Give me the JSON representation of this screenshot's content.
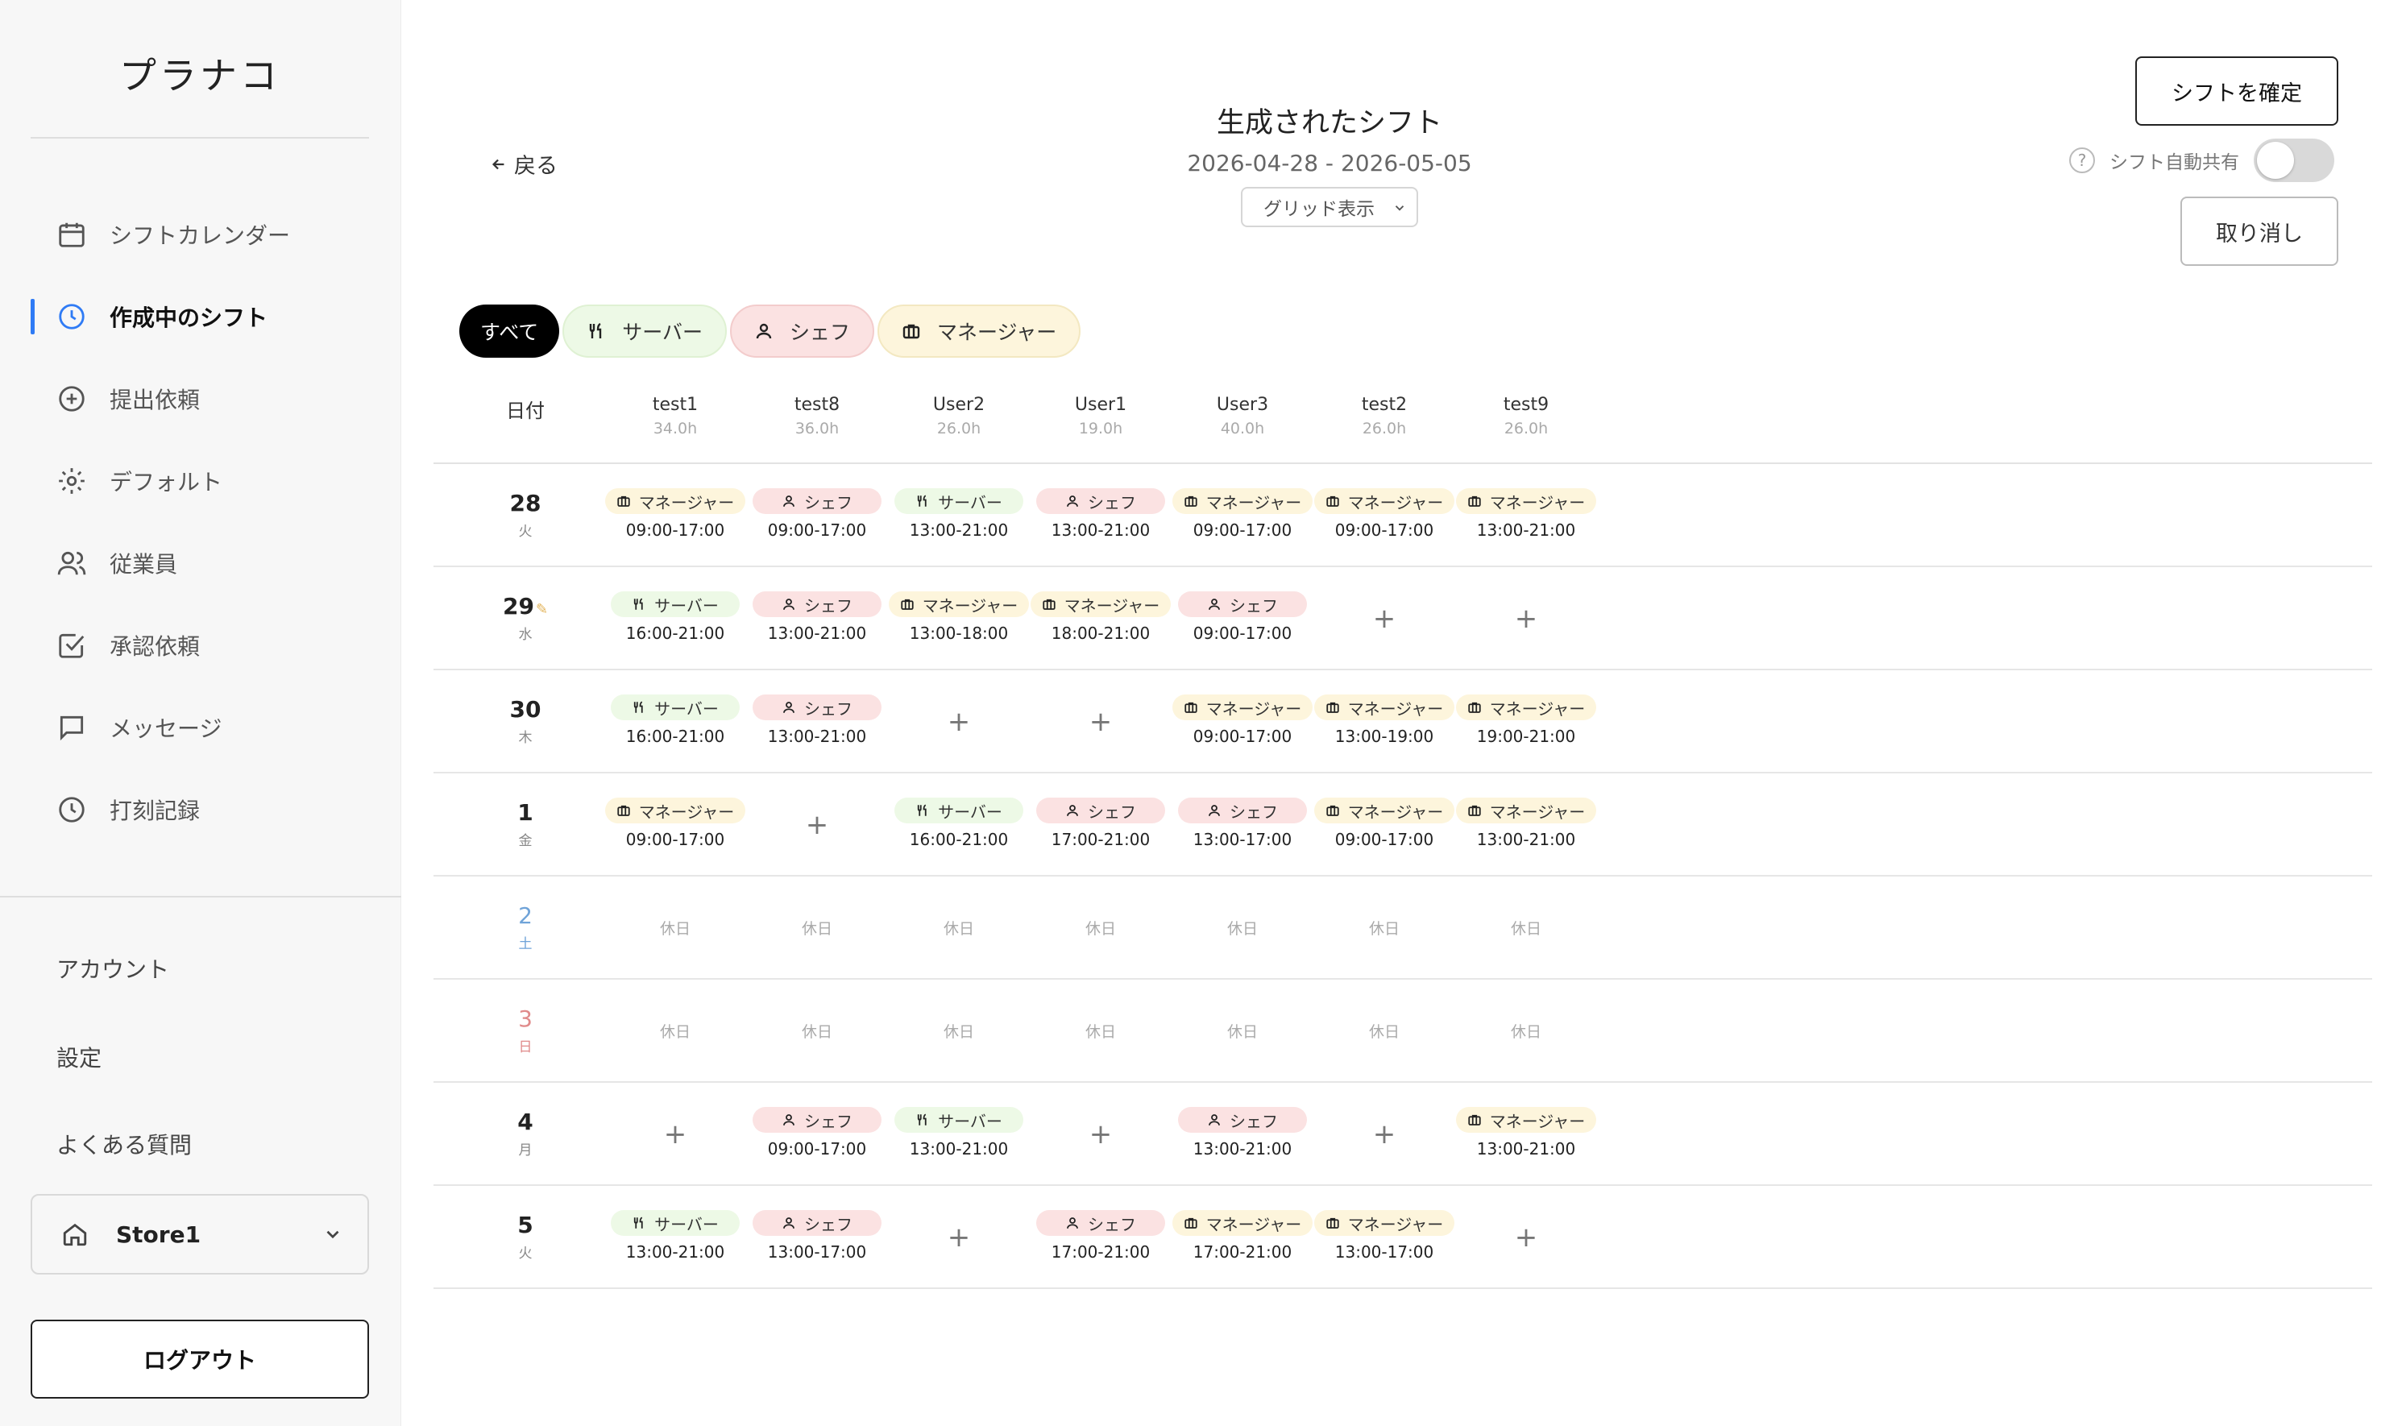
{
  "app": {
    "logo": "プラナコ"
  },
  "sidebar": {
    "nav": [
      {
        "label": "シフトカレンダー",
        "icon": "calendar-icon",
        "active": false
      },
      {
        "label": "作成中のシフト",
        "icon": "clock-icon",
        "active": true
      },
      {
        "label": "提出依頼",
        "icon": "plus-circle-icon",
        "active": false
      },
      {
        "label": "デフォルト",
        "icon": "gear-icon",
        "active": false
      },
      {
        "label": "従業員",
        "icon": "users-icon",
        "active": false
      },
      {
        "label": "承認依頼",
        "icon": "check-square-icon",
        "active": false
      },
      {
        "label": "メッセージ",
        "icon": "message-icon",
        "active": false
      },
      {
        "label": "打刻記録",
        "icon": "clock-icon",
        "active": false
      }
    ],
    "links": [
      "アカウント",
      "設定",
      "よくある質問"
    ],
    "store": "Store1",
    "logout": "ログアウト"
  },
  "header": {
    "back": "戻る",
    "title": "生成されたシフト",
    "range": "2026-04-28 - 2026-05-05",
    "view": "グリッド表示",
    "confirm": "シフトを確定",
    "help": "?",
    "auto_share": "シフト自動共有",
    "auto_share_on": false,
    "cancel": "取り消し"
  },
  "filters": {
    "all": "すべて",
    "server": "サーバー",
    "chef": "シェフ",
    "manager": "マネージャー"
  },
  "roles": {
    "server": "サーバー",
    "chef": "シェフ",
    "manager": "マネージャー"
  },
  "grid": {
    "date_header": "日付",
    "off_label": "休日",
    "plus": "+",
    "pencil": "✎",
    "employees": [
      {
        "name": "test1",
        "hours": "34.0h"
      },
      {
        "name": "test8",
        "hours": "36.0h"
      },
      {
        "name": "User2",
        "hours": "26.0h"
      },
      {
        "name": "User1",
        "hours": "19.0h"
      },
      {
        "name": "User3",
        "hours": "40.0h"
      },
      {
        "name": "test2",
        "hours": "26.0h"
      },
      {
        "name": "test9",
        "hours": "26.0h"
      }
    ],
    "days": [
      {
        "day": "28",
        "weekday": "火",
        "kind": "normal",
        "edited": false,
        "cells": [
          {
            "role": "manager",
            "time": "09:00-17:00"
          },
          {
            "role": "chef",
            "time": "09:00-17:00"
          },
          {
            "role": "server",
            "time": "13:00-21:00"
          },
          {
            "role": "chef",
            "time": "13:00-21:00"
          },
          {
            "role": "manager",
            "time": "09:00-17:00"
          },
          {
            "role": "manager",
            "time": "09:00-17:00"
          },
          {
            "role": "manager",
            "time": "13:00-21:00"
          }
        ]
      },
      {
        "day": "29",
        "weekday": "水",
        "kind": "normal",
        "edited": true,
        "cells": [
          {
            "role": "server",
            "time": "16:00-21:00"
          },
          {
            "role": "chef",
            "time": "13:00-21:00"
          },
          {
            "role": "manager",
            "time": "13:00-18:00"
          },
          {
            "role": "manager",
            "time": "18:00-21:00"
          },
          {
            "role": "chef",
            "time": "09:00-17:00"
          },
          {
            "role": "empty"
          },
          {
            "role": "empty"
          }
        ]
      },
      {
        "day": "30",
        "weekday": "木",
        "kind": "normal",
        "edited": false,
        "cells": [
          {
            "role": "server",
            "time": "16:00-21:00"
          },
          {
            "role": "chef",
            "time": "13:00-21:00"
          },
          {
            "role": "empty"
          },
          {
            "role": "empty"
          },
          {
            "role": "manager",
            "time": "09:00-17:00"
          },
          {
            "role": "manager",
            "time": "13:00-19:00"
          },
          {
            "role": "manager",
            "time": "19:00-21:00"
          }
        ]
      },
      {
        "day": "1",
        "weekday": "金",
        "kind": "normal",
        "edited": false,
        "cells": [
          {
            "role": "manager",
            "time": "09:00-17:00"
          },
          {
            "role": "empty"
          },
          {
            "role": "server",
            "time": "16:00-21:00"
          },
          {
            "role": "chef",
            "time": "17:00-21:00"
          },
          {
            "role": "chef",
            "time": "13:00-17:00"
          },
          {
            "role": "manager",
            "time": "09:00-17:00"
          },
          {
            "role": "manager",
            "time": "13:00-21:00"
          }
        ]
      },
      {
        "day": "2",
        "weekday": "土",
        "kind": "sat",
        "edited": false,
        "cells": [
          {
            "role": "off"
          },
          {
            "role": "off"
          },
          {
            "role": "off"
          },
          {
            "role": "off"
          },
          {
            "role": "off"
          },
          {
            "role": "off"
          },
          {
            "role": "off"
          }
        ]
      },
      {
        "day": "3",
        "weekday": "日",
        "kind": "sun",
        "edited": false,
        "cells": [
          {
            "role": "off"
          },
          {
            "role": "off"
          },
          {
            "role": "off"
          },
          {
            "role": "off"
          },
          {
            "role": "off"
          },
          {
            "role": "off"
          },
          {
            "role": "off"
          }
        ]
      },
      {
        "day": "4",
        "weekday": "月",
        "kind": "normal",
        "edited": false,
        "cells": [
          {
            "role": "empty"
          },
          {
            "role": "chef",
            "time": "09:00-17:00"
          },
          {
            "role": "server",
            "time": "13:00-21:00"
          },
          {
            "role": "empty"
          },
          {
            "role": "chef",
            "time": "13:00-21:00"
          },
          {
            "role": "empty"
          },
          {
            "role": "manager",
            "time": "13:00-21:00"
          }
        ]
      },
      {
        "day": "5",
        "weekday": "火",
        "kind": "normal",
        "edited": false,
        "cells": [
          {
            "role": "server",
            "time": "13:00-21:00"
          },
          {
            "role": "chef",
            "time": "13:00-17:00"
          },
          {
            "role": "empty"
          },
          {
            "role": "chef",
            "time": "17:00-21:00"
          },
          {
            "role": "manager",
            "time": "17:00-21:00"
          },
          {
            "role": "manager",
            "time": "13:00-17:00"
          },
          {
            "role": "empty"
          }
        ]
      }
    ]
  },
  "colors": {
    "accent": "#2f7bf5",
    "server_bg": "#edf9e6",
    "chef_bg": "#fbe2e2",
    "manager_bg": "#fdf5dc"
  }
}
